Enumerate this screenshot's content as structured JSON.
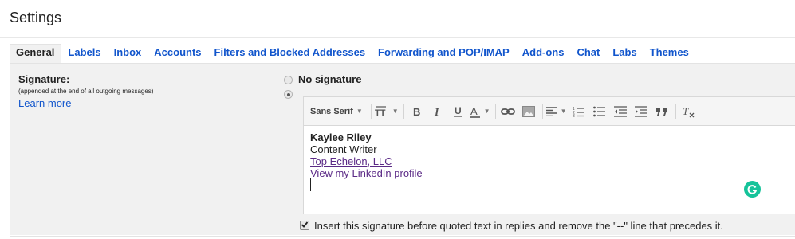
{
  "page": {
    "title": "Settings"
  },
  "tabs": [
    {
      "label": "General",
      "active": true
    },
    {
      "label": "Labels"
    },
    {
      "label": "Inbox"
    },
    {
      "label": "Accounts"
    },
    {
      "label": "Filters and Blocked Addresses"
    },
    {
      "label": "Forwarding and POP/IMAP"
    },
    {
      "label": "Add-ons"
    },
    {
      "label": "Chat"
    },
    {
      "label": "Labs"
    },
    {
      "label": "Themes"
    }
  ],
  "signature": {
    "label": "Signature:",
    "note": "(appended at the end of all outgoing messages)",
    "learn_more": "Learn more",
    "no_signature_label": "No signature",
    "selected": "custom"
  },
  "toolbar": {
    "font_name": "Sans Serif",
    "icons": [
      "font-family-dropdown",
      "text-size-icon",
      "bold-icon",
      "italic-icon",
      "underline-icon",
      "text-color-icon",
      "link-icon",
      "image-icon",
      "align-icon",
      "numbered-list-icon",
      "bulleted-list-icon",
      "indent-less-icon",
      "indent-more-icon",
      "quote-icon",
      "remove-formatting-icon"
    ]
  },
  "editor": {
    "lines": [
      {
        "text": "Kaylee Riley",
        "style": "bold"
      },
      {
        "text": "Content Writer",
        "style": "normal"
      },
      {
        "text": "Top Echelon, LLC",
        "style": "link"
      },
      {
        "text": "View my LinkedIn profile",
        "style": "link"
      }
    ]
  },
  "insert_option": {
    "label": "Insert this signature before quoted text in replies and remove the \"--\" line that precedes it.",
    "checked": true
  },
  "colors": {
    "link_blue": "#1155cc",
    "visited_purple": "#5b2a86",
    "panel_bg": "#f1f1f1",
    "grammarly_green": "#15c39a"
  }
}
